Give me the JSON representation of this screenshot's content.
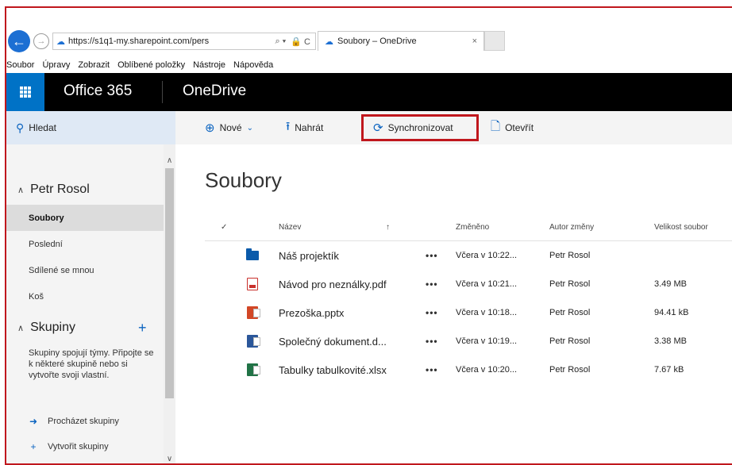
{
  "browser": {
    "url": "https://s1q1-my.sharepoint.com/pers",
    "tab_title": "Soubory – OneDrive",
    "tab_close": "×",
    "addr_controls": [
      "⌕ ▾",
      "🔒 C"
    ]
  },
  "menubar": [
    "Soubor",
    "Úpravy",
    "Zobrazit",
    "Oblíbené položky",
    "Nástroje",
    "Nápověda"
  ],
  "header": {
    "brand": "Office 365",
    "app": "OneDrive"
  },
  "commands": {
    "search": "Hledat",
    "new": "Nové",
    "upload": "Nahrát",
    "sync": "Synchronizovat",
    "open": "Otevřít"
  },
  "sidebar": {
    "user": "Petr Rosol",
    "items": [
      {
        "label": "Soubory",
        "active": true
      },
      {
        "label": "Poslední",
        "active": false
      },
      {
        "label": "Sdílené se mnou",
        "active": false
      },
      {
        "label": "Koš",
        "active": false
      }
    ],
    "groups_title": "Skupiny",
    "groups_desc": "Skupiny spojují týmy. Připojte se k některé skupině nebo si vytvořte svoji vlastní.",
    "browse_groups": "Procházet skupiny",
    "create_group": "Vytvořit skupiny"
  },
  "main": {
    "title": "Soubory",
    "columns": {
      "check": "✓",
      "name": "Název",
      "sort": "↑",
      "modified": "Změněno",
      "author": "Autor změny",
      "size": "Velikost soubor"
    },
    "files": [
      {
        "type": "folder",
        "icon": "folder-icon",
        "name": "Náš projektík",
        "more": "•••",
        "modified": "Včera v 10:22...",
        "author": "Petr Rosol",
        "size": ""
      },
      {
        "type": "pdf",
        "icon": "pdf-file-icon",
        "name": "Návod pro neználky.pdf",
        "more": "•••",
        "modified": "Včera v 10:21...",
        "author": "Petr Rosol",
        "size": "3.49 MB"
      },
      {
        "type": "pptx",
        "icon": "powerpoint-file-icon",
        "name": "Prezoška.pptx",
        "more": "•••",
        "modified": "Včera v 10:18...",
        "author": "Petr Rosol",
        "size": "94.41 kB"
      },
      {
        "type": "docx",
        "icon": "word-file-icon",
        "name": "Společný dokument.d...",
        "more": "•••",
        "modified": "Včera v 10:19...",
        "author": "Petr Rosol",
        "size": "3.38 MB"
      },
      {
        "type": "xlsx",
        "icon": "excel-file-icon",
        "name": "Tabulky tabulkovité.xlsx",
        "more": "•••",
        "modified": "Včera v 10:20...",
        "author": "Petr Rosol",
        "size": "7.67 kB"
      }
    ]
  },
  "colors": {
    "accent": "#0072c6",
    "highlight_border": "#c0171d",
    "topbar": "#000000"
  }
}
